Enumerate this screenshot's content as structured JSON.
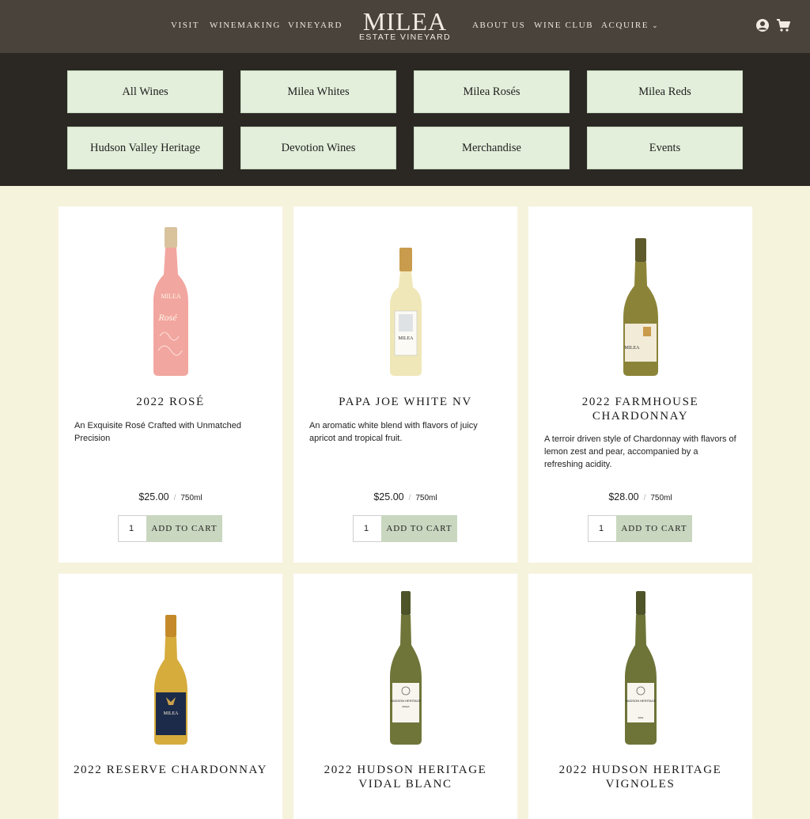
{
  "nav": {
    "left": [
      "VISIT",
      "WINEMAKING",
      "VINEYARD"
    ],
    "right": [
      "ABOUT US",
      "WINE CLUB",
      "ACQUIRE"
    ],
    "logo_main": "MILEA",
    "logo_sub": "ESTATE VINEYARD",
    "icons": [
      "account-icon",
      "cart-icon"
    ]
  },
  "categories": [
    "All Wines",
    "Milea Whites",
    "Milea Rosés",
    "Milea Reds",
    "Hudson Valley Heritage",
    "Devotion Wines",
    "Merchandise",
    "Events"
  ],
  "products": [
    {
      "name": "2022 ROSÉ",
      "description": "An Exquisite Rosé Crafted with Unmatched Precision",
      "price": "$25.00",
      "separator": "/",
      "volume": "750ml",
      "qty": "1",
      "button": "ADD TO CART",
      "bottle_color": "#f2a6a0"
    },
    {
      "name": "PAPA JOE WHITE NV",
      "description": "An aromatic white blend with flavors of juicy apricot and tropical fruit.",
      "price": "$25.00",
      "separator": "/",
      "volume": "750ml",
      "qty": "1",
      "button": "ADD TO CART",
      "bottle_color": "#efe7b8"
    },
    {
      "name": "2022 FARMHOUSE CHARDONNAY",
      "description": "A terroir driven style of Chardonnay with flavors of lemon zest and pear, accompanied by a refreshing acidity.",
      "price": "$28.00",
      "separator": "/",
      "volume": "750ml",
      "qty": "1",
      "button": "ADD TO CART",
      "bottle_color": "#8b8438"
    },
    {
      "name": "2022 RESERVE CHARDONNAY",
      "description": "",
      "bottle_color": "#d6ac3d"
    },
    {
      "name": "2022 HUDSON HERITAGE VIDAL BLANC",
      "description": "",
      "bottle_color": "#6f7539"
    },
    {
      "name": "2022 HUDSON HERITAGE VIGNOLES",
      "description": "",
      "bottle_color": "#6e7438"
    }
  ],
  "bottle_label_text": [
    "MILEA",
    "Rosé",
    "MILEA",
    "MILEA",
    "MILEA",
    "HUDSON HERITAGE",
    "MILEA",
    "HUDSON HERITAGE",
    "2022"
  ]
}
